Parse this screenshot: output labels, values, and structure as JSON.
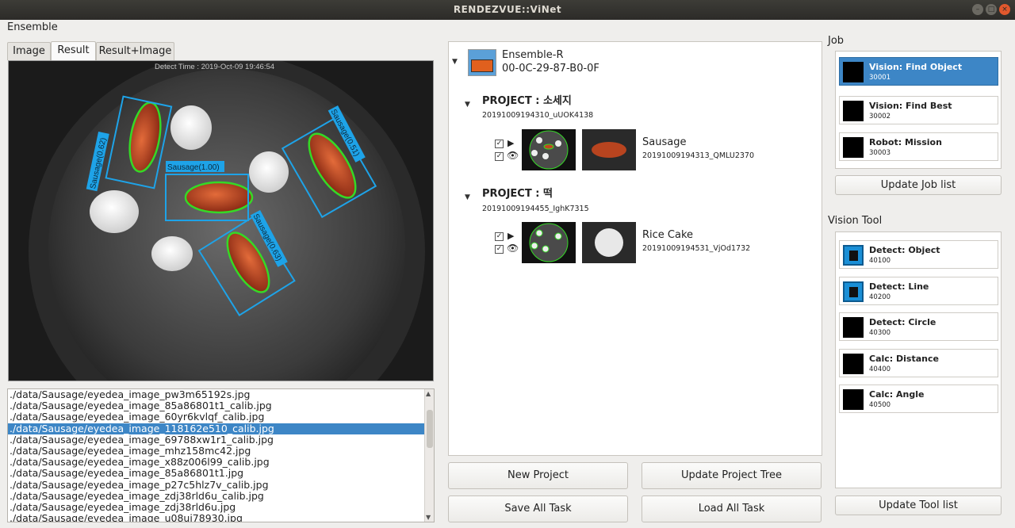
{
  "window": {
    "title": "RENDEZVUE::ViNet"
  },
  "menu": {
    "ensemble": "Ensemble"
  },
  "tabs": [
    {
      "label": "Image"
    },
    {
      "label": "Result"
    },
    {
      "label": "Result+Image"
    }
  ],
  "image_view": {
    "detect_time": "Detect Time : 2019-Oct-09 19:46:54",
    "detections": [
      "Sausage(0.62)",
      "Sausage(1.00)",
      "Sausage(0.51)",
      "Sausage(0.63)"
    ]
  },
  "file_list": {
    "selected_index": 3,
    "items": [
      "./data/Sausage/eyedea_image_pw3m65192s.jpg",
      "./data/Sausage/eyedea_image_85a86801t1_calib.jpg",
      "./data/Sausage/eyedea_image_60yr6kvlqf_calib.jpg",
      "./data/Sausage/eyedea_image_118162e510_calib.jpg",
      "./data/Sausage/eyedea_image_69788xw1r1_calib.jpg",
      "./data/Sausage/eyedea_image_mhz158mc42.jpg",
      "./data/Sausage/eyedea_image_x88z006l99_calib.jpg",
      "./data/Sausage/eyedea_image_85a86801t1.jpg",
      "./data/Sausage/eyedea_image_p27c5hlz7v_calib.jpg",
      "./data/Sausage/eyedea_image_zdj38rld6u_calib.jpg",
      "./data/Sausage/eyedea_image_zdj38rld6u.jpg",
      "./data/Sausage/eyedea_image_u08ui78930.jpg"
    ]
  },
  "tree": {
    "root": {
      "name": "Ensemble-R",
      "mac": "00-0C-29-87-B0-0F"
    },
    "projects": [
      {
        "heading": "PROJECT : 소세지",
        "id": "20191009194310_uUOK4138",
        "task": {
          "name": "Sausage",
          "id": "20191009194313_QMLU2370"
        }
      },
      {
        "heading": "PROJECT : 떡",
        "id": "20191009194455_IghK7315",
        "task": {
          "name": "Rice Cake",
          "id": "20191009194531_VjOd1732"
        }
      }
    ]
  },
  "buttons": {
    "new_project": "New Project",
    "update_project_tree": "Update Project Tree",
    "save_all_task": "Save All Task",
    "load_all_task": "Load All Task",
    "update_job_list": "Update Job list",
    "update_tool_list": "Update Tool list"
  },
  "job": {
    "label": "Job",
    "items": [
      {
        "name": "Vision: Find Object",
        "code": "30001"
      },
      {
        "name": "Vision: Find Best",
        "code": "30002"
      },
      {
        "name": "Robot: Mission",
        "code": "30003"
      }
    ]
  },
  "vision_tool": {
    "label": "Vision Tool",
    "items": [
      {
        "name": "Detect: Object",
        "code": "40100",
        "icon": "detect-object-icon"
      },
      {
        "name": "Detect: Line",
        "code": "40200",
        "icon": "detect-line-icon"
      },
      {
        "name": "Detect: Circle",
        "code": "40300",
        "icon": "black-square-icon"
      },
      {
        "name": "Calc: Distance",
        "code": "40400",
        "icon": "black-square-icon"
      },
      {
        "name": "Calc: Angle",
        "code": "40500",
        "icon": "black-square-icon"
      }
    ]
  },
  "colors": {
    "selection": "#3d86c6",
    "detect_box": "#1ea3e8",
    "contour": "#35d926"
  }
}
